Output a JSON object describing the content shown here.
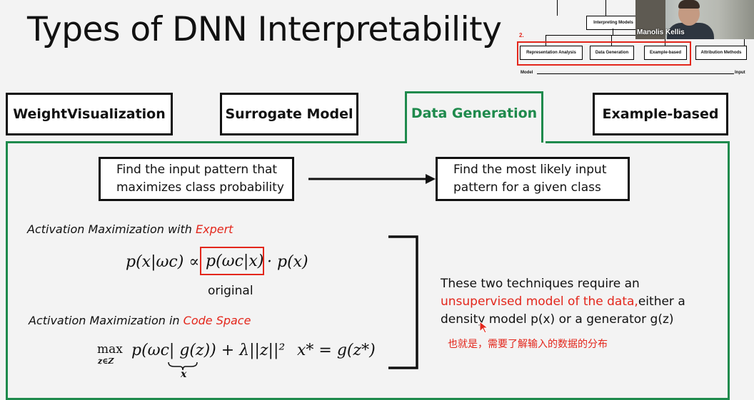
{
  "slide": {
    "title": "Types of DNN Interpretability",
    "tabs": [
      {
        "label": "WeightVisualization"
      },
      {
        "label": "Surrogate Model"
      },
      {
        "label": "Data Generation"
      },
      {
        "label": "Example-based"
      }
    ],
    "flow": {
      "left_line1": "Find the input pattern that",
      "left_line2": "maximizes class probability",
      "right_line1": "Find the most likely input",
      "right_line2": "pattern for a given class"
    },
    "expert_heading_prefix": "Activation Maximization with ",
    "expert_heading_highlight": "Expert",
    "formula1_left": "p(x|ωc) ∝",
    "formula1_box": "p(ωc|x)",
    "formula1_right": "· p(x)",
    "original_label": "original",
    "code_heading_prefix": "Activation Maximization in ",
    "code_heading_highlight": "Code Space",
    "formula2_max": "max",
    "formula2_maxsub": "z∈Z",
    "formula2_body": "p(ωc| g(z)) + λ||z||²",
    "formula2_under": "x",
    "formula2_right": "x* = g(z*)",
    "desc_line1": "These two techniques require an",
    "desc_line2_red": "unsupervised model of the data,",
    "desc_line2_rest": "either a",
    "desc_line3": "density model p(x) or a generator g(z)",
    "subtitle_cn": "也就是，需要了解输入的数据的分布",
    "colors": {
      "accent_green": "#1e8a4c",
      "highlight_red": "#e3261b"
    }
  },
  "mini_diagram": {
    "root": "Interpreting Models",
    "marker": "2.",
    "items": [
      "Representation Analysis",
      "Data Generation",
      "Example-based",
      "Attribution Methods"
    ],
    "axis_left": "Model",
    "axis_right": "Input"
  },
  "video": {
    "name": "Manolis Kellis"
  }
}
